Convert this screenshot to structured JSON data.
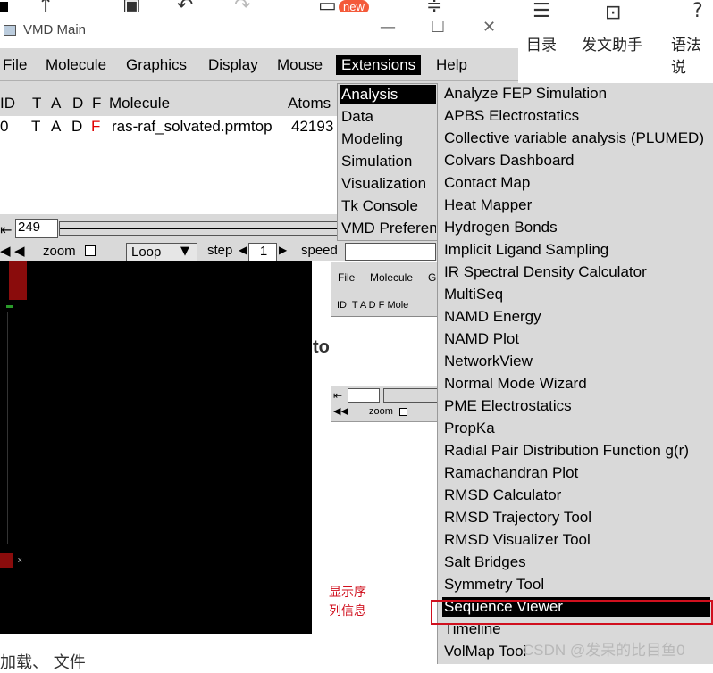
{
  "topbar": {
    "new_badge": "new",
    "toc_label": "目录",
    "assistant_label": "发文助手",
    "grammar_label": "语法说"
  },
  "vmd": {
    "title": "VMD Main",
    "menus": [
      "File",
      "Molecule",
      "Graphics",
      "Display",
      "Mouse",
      "Extensions",
      "Help"
    ],
    "columns": {
      "id": "ID",
      "t": "T",
      "a": "A",
      "d": "D",
      "f": "F",
      "molecule": "Molecule",
      "atoms": "Atoms"
    },
    "row": {
      "id": "0",
      "t": "T",
      "a": "A",
      "d": "D",
      "f": "F",
      "molecule": "ras-raf_solvated.prmtop",
      "atoms": "42193"
    },
    "frame": "249",
    "zoom_label": "zoom",
    "loop_value": "Loop",
    "step_label": "step",
    "step_value": "1",
    "speed_label": "speed"
  },
  "extensions_menu": [
    "Analysis",
    "Data",
    "Modeling",
    "Simulation",
    "Visualization",
    "Tk Console",
    "VMD Preferen"
  ],
  "analysis_submenu": [
    "Analyze FEP Simulation",
    "APBS Electrostatics",
    "Collective variable analysis (PLUMED)",
    "Colvars Dashboard",
    "Contact Map",
    "Heat Mapper",
    "Hydrogen Bonds",
    "Implicit Ligand Sampling",
    "IR Spectral Density Calculator",
    "MultiSeq",
    "NAMD Energy",
    "NAMD Plot",
    "NetworkView",
    "Normal Mode Wizard",
    "PME Electrostatics",
    "PropKa",
    "Radial Pair Distribution Function g(r)",
    "Ramachandran Plot",
    "RMSD Calculator",
    "RMSD Trajectory Tool",
    "RMSD Visualizer Tool",
    "Salt Bridges",
    "Symmetry Tool",
    "Sequence Viewer",
    "Timeline",
    "VolMap Tool"
  ],
  "thumbnail": {
    "menus": [
      "File",
      "Molecule",
      "G"
    ],
    "header": "ID  T A D F Mole",
    "zoom_label": "zoom"
  },
  "annotation": {
    "line1": "显示序",
    "line2": "列信息"
  },
  "watermark": "CSDN @发呆的比目鱼0",
  "background": {
    "fragment_top": "to",
    "fragment_bottom": "加载、 文件"
  },
  "colors": {
    "highlight_box": "#d0101e",
    "menu_bg": "#d9d9d9",
    "selected_bg": "#000000"
  }
}
